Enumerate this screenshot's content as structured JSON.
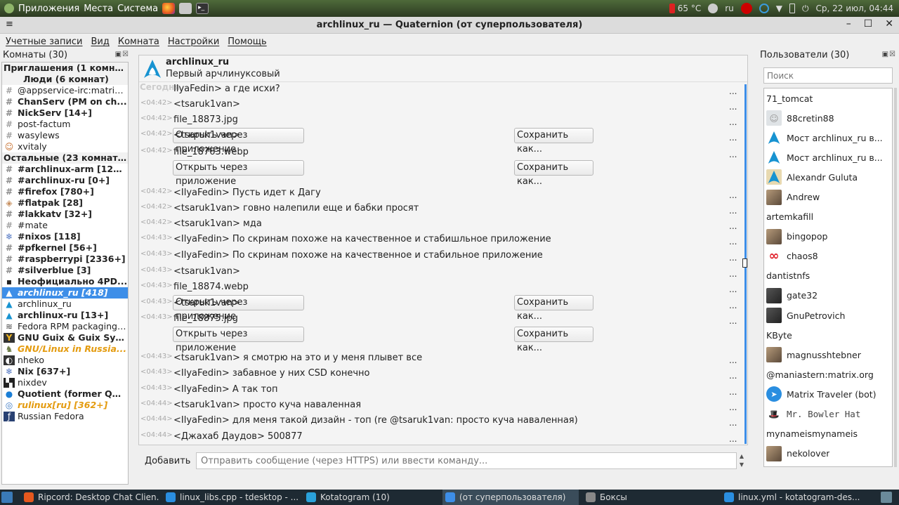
{
  "system_bar": {
    "menus": [
      "Приложения",
      "Места",
      "Система"
    ],
    "temperature": "65 °C",
    "keyboard_layout": "ru",
    "clock": "Ср, 22 июл, 04:44"
  },
  "window": {
    "title": "archlinux_ru — Quaternion (от суперпользователя)"
  },
  "menubar": [
    "Учетные записи",
    "Вид",
    "Комната",
    "Настройки",
    "Помощь"
  ],
  "rooms_panel": {
    "header": "Комнаты (30)",
    "groups": [
      {
        "label": "Приглашения (1 комна...",
        "center": false
      },
      {
        "label": "Люди (6 комнат)",
        "center": true
      }
    ],
    "rooms": [
      {
        "icon": "hash-icon",
        "label": "Приглашения (1 комна...",
        "style": "grp"
      },
      {
        "icon": "",
        "label": "Люди (6 комнат)",
        "style": "grp-center"
      },
      {
        "icon": "hash-icon",
        "label": "@appservice-irc:matrix....",
        "style": ""
      },
      {
        "icon": "hash-icon",
        "label": "ChanServ (PM on ch...",
        "style": "bold"
      },
      {
        "icon": "hash-icon",
        "label": "NickServ [14+]",
        "style": "bold"
      },
      {
        "icon": "hash-icon",
        "label": "post-factum",
        "style": ""
      },
      {
        "icon": "hash-icon",
        "label": "wasylews",
        "style": ""
      },
      {
        "icon": "user-avatar-icon",
        "label": "xvitaly",
        "style": ""
      },
      {
        "icon": "",
        "label": "Остальные (23 комнаты)",
        "style": "grp"
      },
      {
        "icon": "hash-icon",
        "label": "#archlinux-arm [120...",
        "style": "bold"
      },
      {
        "icon": "hash-icon",
        "label": "#archlinux-ru [0+]",
        "style": "bold"
      },
      {
        "icon": "hash-icon",
        "label": "#firefox [780+]",
        "style": "bold"
      },
      {
        "icon": "flatpak-icon",
        "label": "#flatpak [28]",
        "style": "bold"
      },
      {
        "icon": "hash-icon",
        "label": "#lakkatv [32+]",
        "style": "bold"
      },
      {
        "icon": "hash-icon",
        "label": "#mate",
        "style": ""
      },
      {
        "icon": "nixos-icon",
        "label": "#nixos [118]",
        "style": "bold"
      },
      {
        "icon": "hash-icon",
        "label": "#pfkernel [56+]",
        "style": "bold"
      },
      {
        "icon": "hash-icon",
        "label": "#raspberrypi [2336+]",
        "style": "bold"
      },
      {
        "icon": "hash-icon",
        "label": "#silverblue [3]",
        "style": "bold"
      },
      {
        "icon": "room-avatar-icon",
        "label": "Неофициально 4PD...",
        "style": "bold"
      },
      {
        "icon": "arch-icon",
        "label": "archlinux_ru [418]",
        "style": "sel"
      },
      {
        "icon": "arch-icon",
        "label": "archlinux_ru",
        "style": ""
      },
      {
        "icon": "arch-icon",
        "label": "archlinux-ru [13+]",
        "style": "bold"
      },
      {
        "icon": "fedora-rpm-icon",
        "label": "Fedora RPM packaging ...",
        "style": ""
      },
      {
        "icon": "guix-icon",
        "label": "GNU Guix & Guix Sys...",
        "style": "bold"
      },
      {
        "icon": "gnu-icon",
        "label": "GNU/Linux in Russia...",
        "style": "hl"
      },
      {
        "icon": "nheko-icon",
        "label": "nheko",
        "style": ""
      },
      {
        "icon": "nixos-icon",
        "label": "Nix [637+]",
        "style": "bold"
      },
      {
        "icon": "nixdev-icon",
        "label": "nixdev",
        "style": ""
      },
      {
        "icon": "quotient-icon",
        "label": "Quotient (former QM...",
        "style": "bold"
      },
      {
        "icon": "rulinux-icon",
        "label": "rulinux[ru] [362+]",
        "style": "hl"
      },
      {
        "icon": "fedora-icon",
        "label": "Russian Fedora",
        "style": ""
      }
    ]
  },
  "room": {
    "name": "archlinux_ru",
    "topic": "Первый арчлинуксовый",
    "day_separator": "Сегодня",
    "messages": [
      {
        "time": "",
        "text": "IlyaFedin> а где исхи?",
        "kind": "text"
      },
      {
        "time": "<04:42>",
        "text": "<tsaruk1van>",
        "kind": "text"
      },
      {
        "time": "<04:42>",
        "text": "file_18873.jpg",
        "kind": "file"
      },
      {
        "time": "<04:42>",
        "text": "<tsaruk1van>",
        "kind": "text"
      },
      {
        "time": "<04:42>",
        "text": "file_18763.webp",
        "kind": "file"
      },
      {
        "time": "<04:42>",
        "text": "<IlyaFedin> Пусть идет к Дагу",
        "kind": "text"
      },
      {
        "time": "<04:42>",
        "text": "<tsaruk1van> говно налепили еще и бабки просят",
        "kind": "text"
      },
      {
        "time": "<04:42>",
        "text": "<tsaruk1van> мда",
        "kind": "text"
      },
      {
        "time": "<04:43>",
        "text": "<IlyaFedin> По скринам похоже на качественное и стабишльное приложение",
        "kind": "text"
      },
      {
        "time": "<04:43>",
        "text": "<IlyaFedin> По скринам похоже на качественное и стабильное приложение",
        "kind": "text"
      },
      {
        "time": "<04:43>",
        "text": "<tsaruk1van>",
        "kind": "text"
      },
      {
        "time": "<04:43>",
        "text": "file_18874.webp",
        "kind": "file"
      },
      {
        "time": "<04:43>",
        "text": "<tsaruk1van>",
        "kind": "text"
      },
      {
        "time": "<04:43>",
        "text": "file_18875.jpg",
        "kind": "file"
      },
      {
        "time": "<04:43>",
        "text": "<tsaruk1van> я смотрю на это и у меня плывет все",
        "kind": "text"
      },
      {
        "time": "<04:43>",
        "text": "<IlyaFedin> забавное у них CSD конечно",
        "kind": "text"
      },
      {
        "time": "<04:43>",
        "text": "<IlyaFedin> А так топ",
        "kind": "text"
      },
      {
        "time": "<04:44>",
        "text": "<tsaruk1van> просто куча наваленная",
        "kind": "text"
      },
      {
        "time": "<04:44>",
        "text": "<IlyaFedin> для меня такой дизайн - топ (re @tsaruk1van: просто куча наваленная)",
        "kind": "text"
      },
      {
        "time": "<04:44>",
        "text": "<Джахаб Даудов> 500877",
        "kind": "text"
      }
    ],
    "open_with_label": "Открыть через приложение",
    "save_as_label": "Сохранить как...",
    "more_label": "..."
  },
  "composer": {
    "label": "Добавить",
    "placeholder": "Отправить сообщение (через HTTPS) или ввести команду..."
  },
  "users_panel": {
    "header": "Пользователи (30)",
    "search_placeholder": "Поиск",
    "users": [
      {
        "name": "71_tomcat",
        "avatar": "none"
      },
      {
        "name": "88cretin88",
        "avatar": "generic"
      },
      {
        "name": "Мост archlinux_ru в...",
        "avatar": "arch"
      },
      {
        "name": "Мост archlinux_ru в...",
        "avatar": "arch"
      },
      {
        "name": "Alexandr Guluta",
        "avatar": "arch-photo"
      },
      {
        "name": "Andrew",
        "avatar": "photo"
      },
      {
        "name": "artemkafill",
        "avatar": "none"
      },
      {
        "name": "bingopop",
        "avatar": "photo"
      },
      {
        "name": "chaos8",
        "avatar": "chaos"
      },
      {
        "name": "dantistnfs",
        "avatar": "none"
      },
      {
        "name": "gate32",
        "avatar": "photo-dark"
      },
      {
        "name": "GnuPetrovich",
        "avatar": "photo-dark"
      },
      {
        "name": "KByte",
        "avatar": "none"
      },
      {
        "name": "magnusshtebner",
        "avatar": "photo"
      },
      {
        "name": "@maniastern:matrix.org",
        "avatar": "none"
      },
      {
        "name": "Matrix Traveler (bot)",
        "avatar": "bot"
      },
      {
        "name": "Mr. Bowler Hat",
        "avatar": "hat"
      },
      {
        "name": "mynameismynameis",
        "avatar": "none"
      },
      {
        "name": "nekolover",
        "avatar": "photo"
      }
    ]
  },
  "taskbar": [
    {
      "label": "Ripcord: Desktop Chat Clien...",
      "icon": "firefox-icon",
      "active": false
    },
    {
      "label": "linux_libs.cpp - tdesktop - ...",
      "icon": "vscode-icon",
      "active": false
    },
    {
      "label": "Kotatogram (10)",
      "icon": "telegram-icon",
      "active": false
    },
    {
      "label": "(от суперпользователя)",
      "icon": "quaternion-icon",
      "active": true
    },
    {
      "label": "Боксы",
      "icon": "boxes-icon",
      "active": false
    },
    {
      "label": "linux.yml - kotatogram-des...",
      "icon": "vscode-icon",
      "active": false
    }
  ],
  "colors": {
    "accent": "#3d8ee8",
    "highlight": "#e49b0f",
    "arch_blue": "#1793d1"
  }
}
